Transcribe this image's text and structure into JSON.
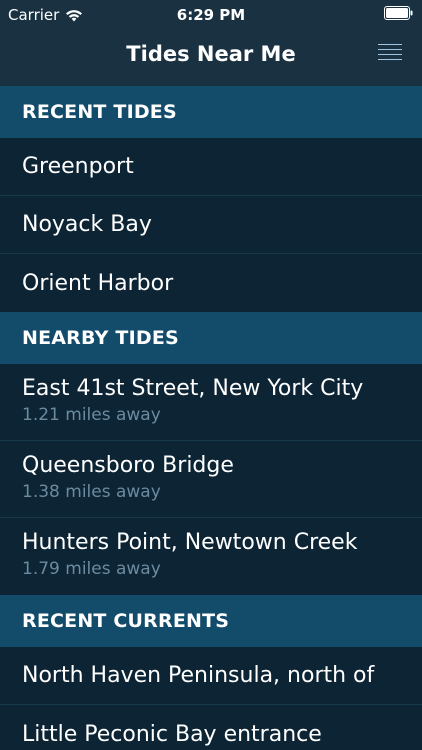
{
  "status_bar": {
    "carrier": "Carrier",
    "time": "6:29 PM"
  },
  "nav": {
    "title": "Tides Near Me",
    "menu_icon": "hamburger-menu-icon"
  },
  "sections": {
    "recent_tides": {
      "header": "RECENT TIDES",
      "items": [
        "Greenport",
        "Noyack Bay",
        "Orient Harbor"
      ]
    },
    "nearby_tides": {
      "header": "NEARBY TIDES",
      "items": [
        {
          "name": "East 41st Street, New York City",
          "distance": "1.21 miles away"
        },
        {
          "name": "Queensboro Bridge",
          "distance": "1.38 miles away"
        },
        {
          "name": "Hunters Point, Newtown Creek",
          "distance": "1.79 miles away"
        }
      ]
    },
    "recent_currents": {
      "header": "RECENT CURRENTS",
      "items": [
        "North Haven Peninsula, north of",
        "Little Peconic Bay entrance"
      ]
    }
  },
  "colors": {
    "background": "#0c2434",
    "nav_bar": "#1a3142",
    "section_header": "#134b6b",
    "subtitle": "#6c8aa0"
  }
}
